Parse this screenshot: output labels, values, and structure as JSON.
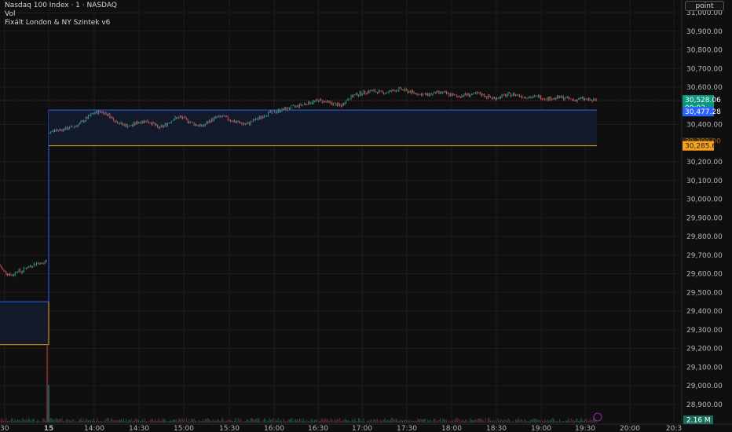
{
  "header": {
    "title": "Nasdaq 100 Index · 1 · NASDAQ",
    "volume_label": "Vol",
    "indicator": "Fixált London & NY Szintek v6"
  },
  "scale_button": "point",
  "colors": {
    "background": "#0f0f0f",
    "up": "#26a69a",
    "down": "#ef5350",
    "blue_level": "#2962ff",
    "orange_level": "#f7a21b",
    "zone_fill": "#131a2c"
  },
  "chart_data": {
    "type": "candlestick",
    "x_ticks": [
      "30",
      "15",
      "14:00",
      "14:30",
      "15:00",
      "15:30",
      "16:00",
      "16:30",
      "17:00",
      "17:30",
      "18:00",
      "18:30",
      "19:00",
      "19:30",
      "20:00",
      "20:3"
    ],
    "y_ticks": [
      "31,000.00",
      "30,900.00",
      "30,800.00",
      "30,700.00",
      "30,600.00",
      "30,400.00",
      "30,200.00",
      "30,100.00",
      "30,000.00",
      "29,900.00",
      "29,800.00",
      "29,700.00",
      "29,600.00",
      "29,500.00",
      "29,400.00",
      "29,300.00",
      "29,200.00",
      "29,100.00",
      "29,000.00",
      "28,900.00"
    ],
    "ylim": [
      28850,
      31030
    ],
    "last_price": {
      "value": 30528.06,
      "label": "30,528.06",
      "countdown": "00:02"
    },
    "levels": [
      {
        "name": "blue",
        "label": "30,477.28",
        "value": 30477.28
      },
      {
        "name": "orange",
        "label": "30,285.63",
        "value": 30285.63
      },
      {
        "name": "orange-dim",
        "label": "30,300.00",
        "value": 30300.0
      }
    ],
    "prev_session_levels": {
      "blue": 29450,
      "orange": 29220
    },
    "volume_badge": "2.16 M",
    "series": [
      {
        "segment": "pre",
        "start": 29650,
        "path": [
          29640,
          29610,
          29600,
          29590,
          29620,
          29610,
          29630,
          29640,
          29650,
          29660,
          29650,
          29670
        ]
      },
      {
        "segment": "session",
        "start": 30350,
        "path": [
          30360,
          30370,
          30375,
          30385,
          30400,
          30430,
          30460,
          30470,
          30455,
          30420,
          30400,
          30390,
          30410,
          30420,
          30410,
          30380,
          30400,
          30430,
          30440,
          30420,
          30400,
          30390,
          30420,
          30440,
          30440,
          30420,
          30410,
          30400,
          30420,
          30440,
          30460,
          30470,
          30480,
          30490,
          30500,
          30510,
          30520,
          30530,
          30520,
          30510,
          30500,
          30540,
          30560,
          30570,
          30580,
          30575,
          30570,
          30580,
          30590,
          30580,
          30570,
          30560,
          30560,
          30570,
          30570,
          30560,
          30550,
          30560,
          30560,
          30565,
          30550,
          30540,
          30550,
          30560,
          30560,
          30550,
          30545,
          30550,
          30540,
          30540,
          30545,
          30540,
          30530,
          30540,
          30530,
          30528
        ]
      }
    ]
  }
}
